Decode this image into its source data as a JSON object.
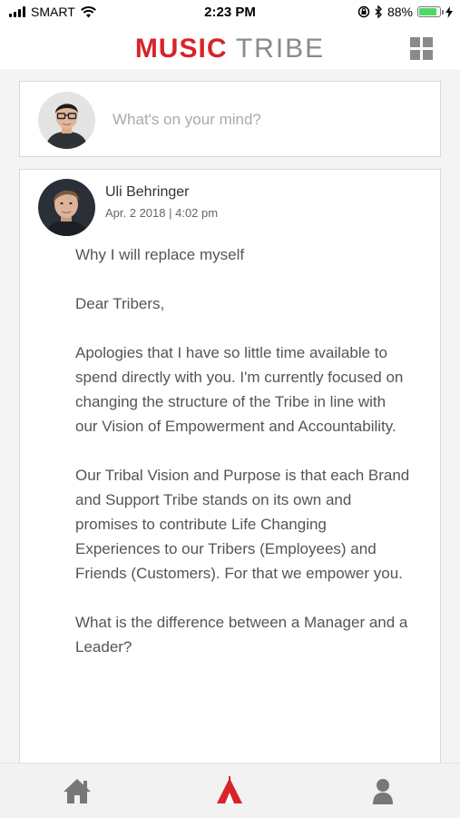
{
  "status_bar": {
    "carrier": "SMART",
    "time": "2:23 PM",
    "battery_percent": "88%",
    "battery_level": 0.88
  },
  "header": {
    "logo_part1": "MUSIC",
    "logo_part2": "TRIBE",
    "menu_icon": "grid-icon"
  },
  "composer": {
    "placeholder": "What's on your mind?"
  },
  "post": {
    "author": "Uli Behringer",
    "date": "Apr. 2 2018 | 4:02 pm",
    "paragraphs": [
      "Why I will replace myself",
      "Dear Tribers,",
      "Apologies that I have so little time available to spend directly with you. I'm currently focused on changing the structure of the Tribe in line with our Vision of Empowerment and Accountability.",
      "Our Tribal Vision and Purpose is that each Brand and Support Tribe stands on its own and promises to contribute Life Changing Experiences to our Tribers (Employees) and Friends (Customers). For that we empower you.",
      "What is the difference between a Manager and a Leader?"
    ]
  },
  "tab_bar": {
    "tabs": [
      "home-icon",
      "tribe-tent-icon",
      "profile-icon"
    ],
    "active_color": "#d8232a",
    "inactive_color": "#777777"
  }
}
